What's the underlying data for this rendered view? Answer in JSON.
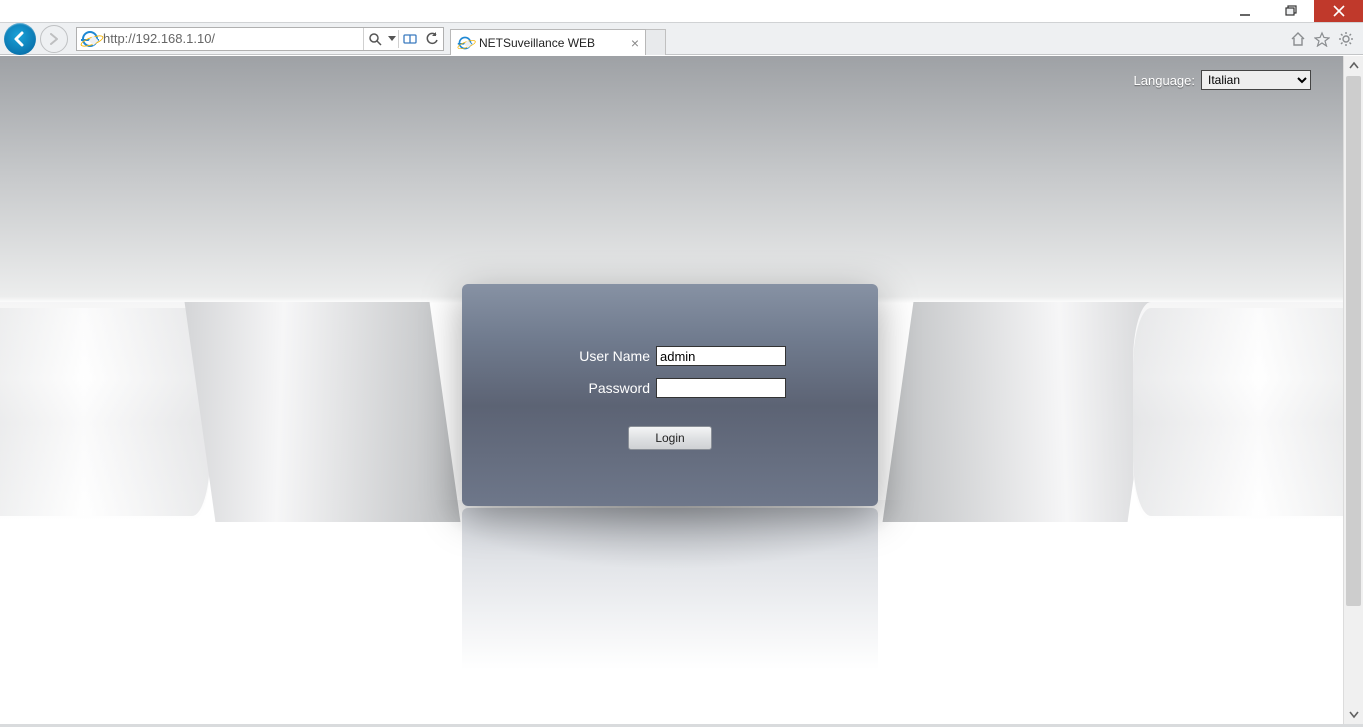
{
  "window": {
    "controls": {
      "minimize": "minimize",
      "maximize": "restore",
      "close": "close"
    }
  },
  "browser": {
    "address": "http://192.168.1.10/",
    "tab_title": "NETSuveillance WEB"
  },
  "page": {
    "language_label": "Language:",
    "language_selected": "Italian",
    "language_options": [
      "Italian"
    ],
    "login": {
      "username_label": "User Name",
      "username_value": "admin",
      "password_label": "Password",
      "password_value": "",
      "submit_label": "Login"
    }
  }
}
